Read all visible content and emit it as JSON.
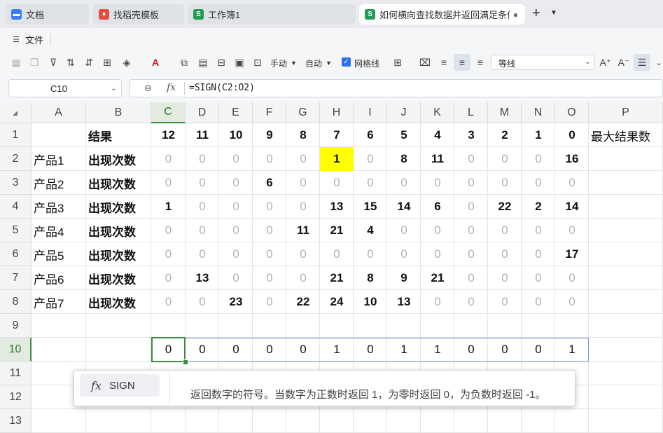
{
  "tabs": [
    {
      "label": "文档",
      "icon": "doc-icon",
      "active": false
    },
    {
      "label": "找稻壳模板",
      "icon": "docer-icon",
      "active": false
    },
    {
      "label": "工作簿1",
      "icon": "sheet-icon",
      "active": false
    },
    {
      "label": "如何横向查找数据并返回满足条件",
      "icon": "sheet-icon",
      "active": true
    }
  ],
  "tab_icon_letters": {
    "doc": "",
    "sheet": "S"
  },
  "menu": {
    "file": "文件"
  },
  "toolbar": {
    "manual": "手动",
    "auto": "自动",
    "gridlines": "网格线",
    "font": "等线",
    "icons": [
      "format-painter-icon",
      "paste-icon",
      "filter-icon",
      "sort-asc-icon",
      "sort-desc-icon",
      "border-icon",
      "fill-color-icon",
      "font-color-icon",
      "convert-icon",
      "freeze-icon",
      "row-col-icon",
      "cell-icon",
      "wrap-icon",
      "align-left-icon",
      "align-center-icon",
      "align-right-icon",
      "font-grow-icon",
      "font-shrink-icon",
      "wrap-text-icon"
    ]
  },
  "colors": {
    "accent": "#3a8d3a",
    "highlight": "#ffff00",
    "zero_text": "#b3b3b3"
  },
  "namebox": {
    "value": "C10"
  },
  "formula": {
    "text": "=SIGN(C2:O2)"
  },
  "columns": [
    "A",
    "B",
    "C",
    "D",
    "E",
    "F",
    "G",
    "H",
    "I",
    "J",
    "K",
    "L",
    "M",
    "N",
    "O",
    "P"
  ],
  "rows": [
    "1",
    "2",
    "3",
    "4",
    "5",
    "6",
    "7",
    "8",
    "9",
    "10",
    "11",
    "12",
    "13"
  ],
  "grid": {
    "header_row": {
      "a": "",
      "b": "结果",
      "values": [
        "12",
        "11",
        "10",
        "9",
        "8",
        "7",
        "6",
        "5",
        "4",
        "3",
        "2",
        "1",
        "0"
      ],
      "p": "最大结果数"
    },
    "data_rows": [
      {
        "a": "产品1",
        "b": "出现次数",
        "values": [
          "0",
          "0",
          "0",
          "0",
          "0",
          "1",
          "0",
          "8",
          "11",
          "0",
          "0",
          "0",
          "16"
        ]
      },
      {
        "a": "产品2",
        "b": "出现次数",
        "values": [
          "0",
          "0",
          "0",
          "6",
          "0",
          "0",
          "0",
          "0",
          "0",
          "0",
          "0",
          "0",
          "0"
        ]
      },
      {
        "a": "产品3",
        "b": "出现次数",
        "values": [
          "1",
          "0",
          "0",
          "0",
          "0",
          "13",
          "15",
          "14",
          "6",
          "0",
          "22",
          "2",
          "14"
        ]
      },
      {
        "a": "产品4",
        "b": "出现次数",
        "values": [
          "0",
          "0",
          "0",
          "0",
          "11",
          "21",
          "4",
          "0",
          "0",
          "0",
          "0",
          "0",
          "0"
        ]
      },
      {
        "a": "产品5",
        "b": "出现次数",
        "values": [
          "0",
          "0",
          "0",
          "0",
          "0",
          "0",
          "0",
          "0",
          "0",
          "0",
          "0",
          "0",
          "17"
        ]
      },
      {
        "a": "产品6",
        "b": "出现次数",
        "values": [
          "0",
          "13",
          "0",
          "0",
          "0",
          "21",
          "8",
          "9",
          "21",
          "0",
          "0",
          "0",
          "0"
        ]
      },
      {
        "a": "产品7",
        "b": "出现次数",
        "values": [
          "0",
          "0",
          "23",
          "0",
          "22",
          "24",
          "10",
          "13",
          "0",
          "0",
          "0",
          "0",
          "0"
        ]
      }
    ],
    "result_row": [
      "0",
      "0",
      "0",
      "0",
      "0",
      "1",
      "0",
      "1",
      "1",
      "0",
      "0",
      "0",
      "1"
    ]
  },
  "tooltip": {
    "function_name": "SIGN",
    "description": "返回数字的符号。当数字为正数时返回 1，为零时返回 0，为负数时返回 -1。"
  }
}
